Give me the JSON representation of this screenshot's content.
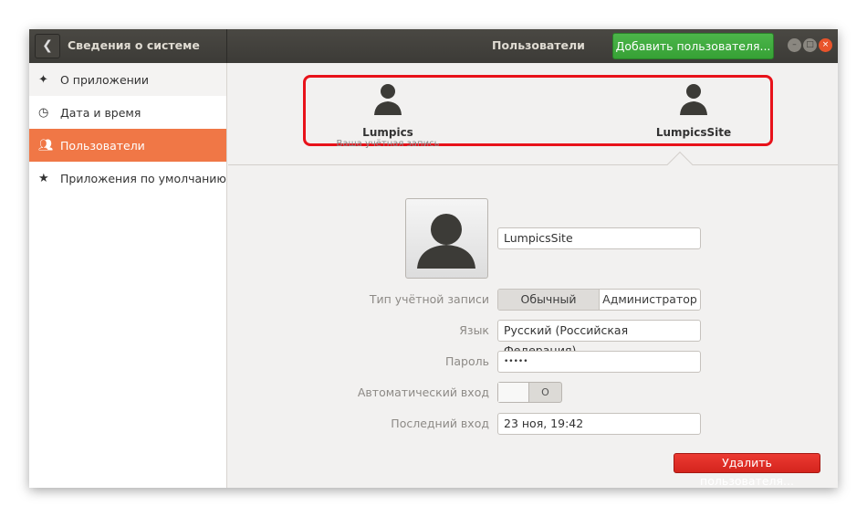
{
  "header": {
    "back_icon": "chevron-left",
    "section_title": "Сведения о системе",
    "page_title": "Пользователи",
    "add_user_label": "Добавить пользователя..."
  },
  "sidebar": {
    "items": [
      {
        "label": "О приложении",
        "icon": "sparkle"
      },
      {
        "label": "Дата и время",
        "icon": "clock"
      },
      {
        "label": "Пользователи",
        "icon": "users",
        "active": true
      },
      {
        "label": "Приложения по умолчанию",
        "icon": "star"
      }
    ]
  },
  "users": [
    {
      "name": "Lumpics",
      "subtitle": "Ваша учётная запись"
    },
    {
      "name": "LumpicsSite",
      "selected": true
    }
  ],
  "details": {
    "username": "LumpicsSite",
    "account_type_label": "Тип учётной записи",
    "account_types": [
      "Обычный",
      "Администратор"
    ],
    "language_label": "Язык",
    "language": "Русский (Российская Федерация)",
    "password_label": "Пароль",
    "password": "•••••",
    "autologin_label": "Автоматический вход",
    "autologin_symbol": "O",
    "last_login_label": "Последний вход",
    "last_login": "23 ноя, 19:42",
    "delete_label": "Удалить пользователя..."
  },
  "colors": {
    "accent": "#f07746",
    "add": "#3fad3e",
    "delete": "#e0302a",
    "highlight": "#e8121a"
  }
}
